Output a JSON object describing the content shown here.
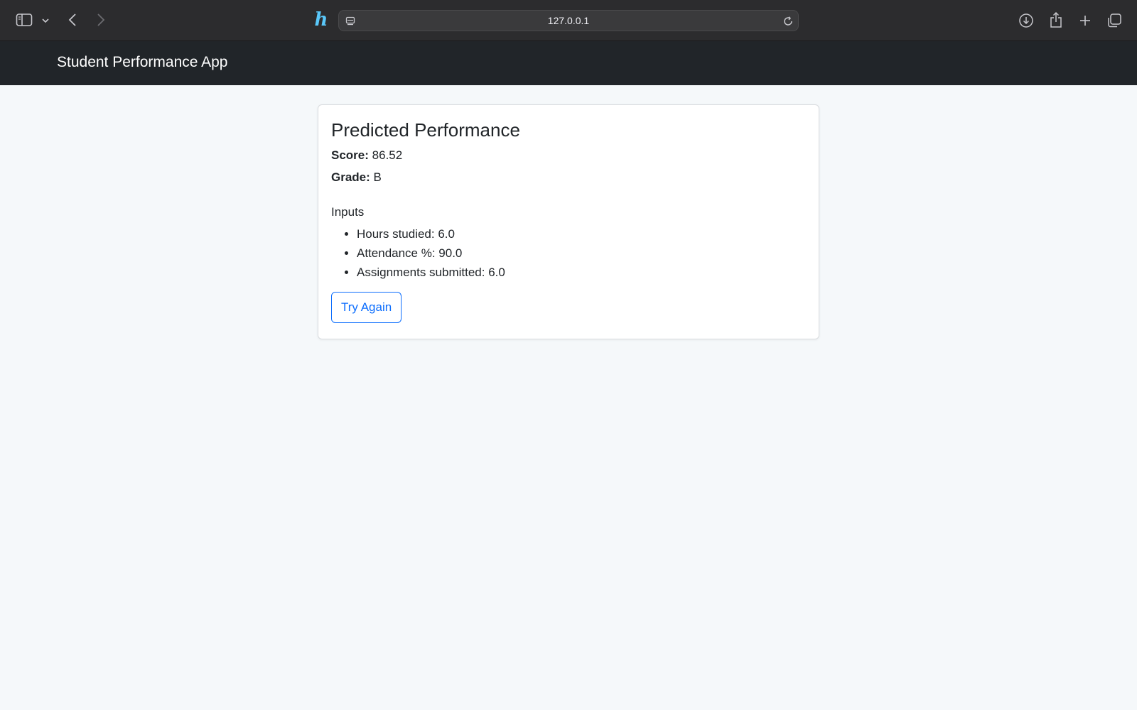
{
  "browser": {
    "url": "127.0.0.1",
    "extension_logo": "h"
  },
  "navbar": {
    "brand": "Student Performance App"
  },
  "result": {
    "title": "Predicted Performance",
    "score_label": "Score:",
    "score_value": "86.52",
    "grade_label": "Grade:",
    "grade_value": "B",
    "inputs_heading": "Inputs",
    "inputs": [
      "Hours studied: 6.0",
      "Attendance %: 90.0",
      "Assignments submitted: 6.0"
    ],
    "try_again_label": "Try Again"
  },
  "colors": {
    "browser_chrome": "#2c2c2e",
    "navbar": "#212529",
    "page_bg": "#f5f8fa",
    "primary": "#0d6efd",
    "logo": "#5ac8fa"
  },
  "icons": [
    "sidebar-toggle-icon",
    "chevron-down-icon",
    "back-arrow-icon",
    "forward-arrow-icon",
    "reader-icon",
    "reload-icon",
    "download-icon",
    "share-icon",
    "new-tab-icon",
    "tab-overview-icon"
  ]
}
